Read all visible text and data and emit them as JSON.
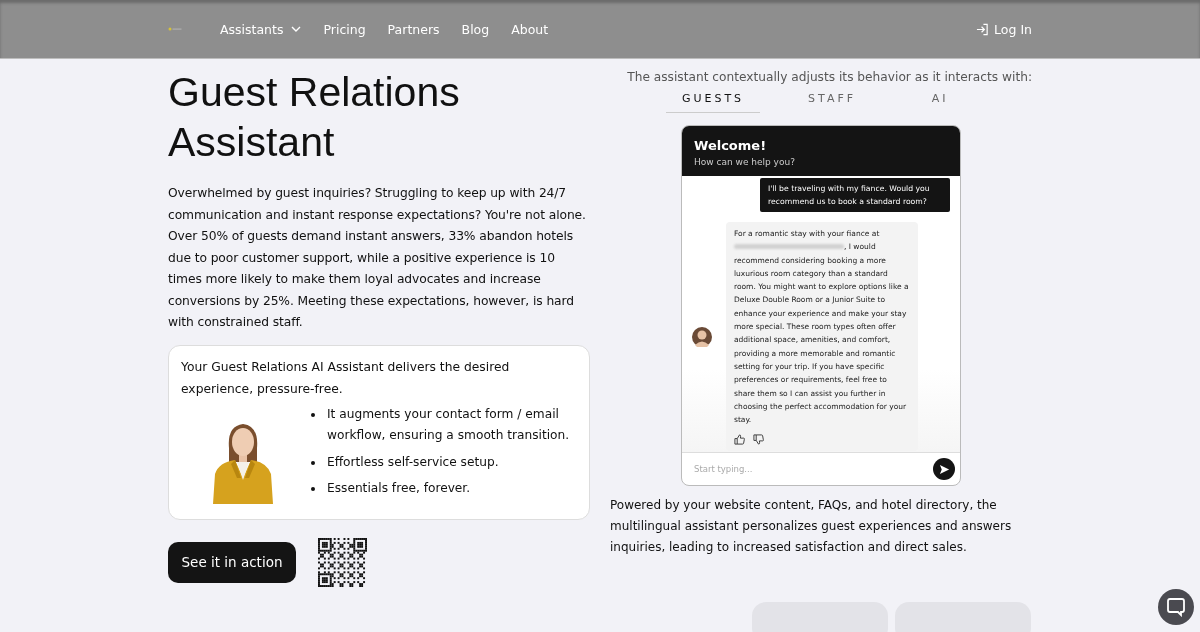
{
  "nav": {
    "items": [
      {
        "label": "Assistants",
        "dropdown": true
      },
      {
        "label": "Pricing",
        "dropdown": false
      },
      {
        "label": "Partners",
        "dropdown": false
      },
      {
        "label": "Blog",
        "dropdown": false
      },
      {
        "label": "About",
        "dropdown": false
      }
    ],
    "login": "Log In"
  },
  "hero": {
    "title": "Guest Relations Assistant",
    "intro": "Overwhelmed by guest inquiries? Struggling to keep up with 24/7 communication and instant response expectations? You're not alone. Over 50% of guests demand instant answers, 33% abandon hotels due to poor customer support, while a positive experience is 10 times more likely to make them loyal advocates and increase conversions by 25%. Meeting these expectations, however, is hard with constrained staff.",
    "card": {
      "lead": "Your Guest Relations AI Assistant delivers the desired experience, pressure-free.",
      "bullets": [
        "It augments your contact form / email workflow, ensuring a smooth transition.",
        "Effortless self-service setup.",
        "Essentials free, forever."
      ]
    },
    "cta": "See it in action"
  },
  "demo": {
    "caption": "The assistant contextually adjusts its behavior as it interacts with:",
    "tabs": [
      {
        "label": "GUESTS",
        "selected": true
      },
      {
        "label": "STAFF",
        "selected": false
      },
      {
        "label": "AI",
        "selected": false
      }
    ],
    "chat": {
      "title": "Welcome!",
      "subtitle": "How can we help you?",
      "user_message": "I'll be traveling with my fiance. Would you recommend us to book a standard room?",
      "reply_start": "For a romantic stay with your fiance at",
      "reply_mid": ", I would",
      "reply_rest": "recommend considering booking a more luxurious room category than a standard room. You might want to explore options like a Deluxe Double Room or a Junior Suite to enhance your experience and make your stay more special. These room types often offer additional space, amenities, and comfort, providing a more memorable and romantic setting for your trip. If you have specific preferences or requirements, feel free to share them so I can assist you further in choosing the perfect accommodation for your stay.",
      "placeholder": "Start typing..."
    },
    "description": "Powered by your website content, FAQs, and hotel directory, the multilingual assistant personalizes guest experiences and answers inquiries, leading to increased satisfaction and direct sales."
  }
}
